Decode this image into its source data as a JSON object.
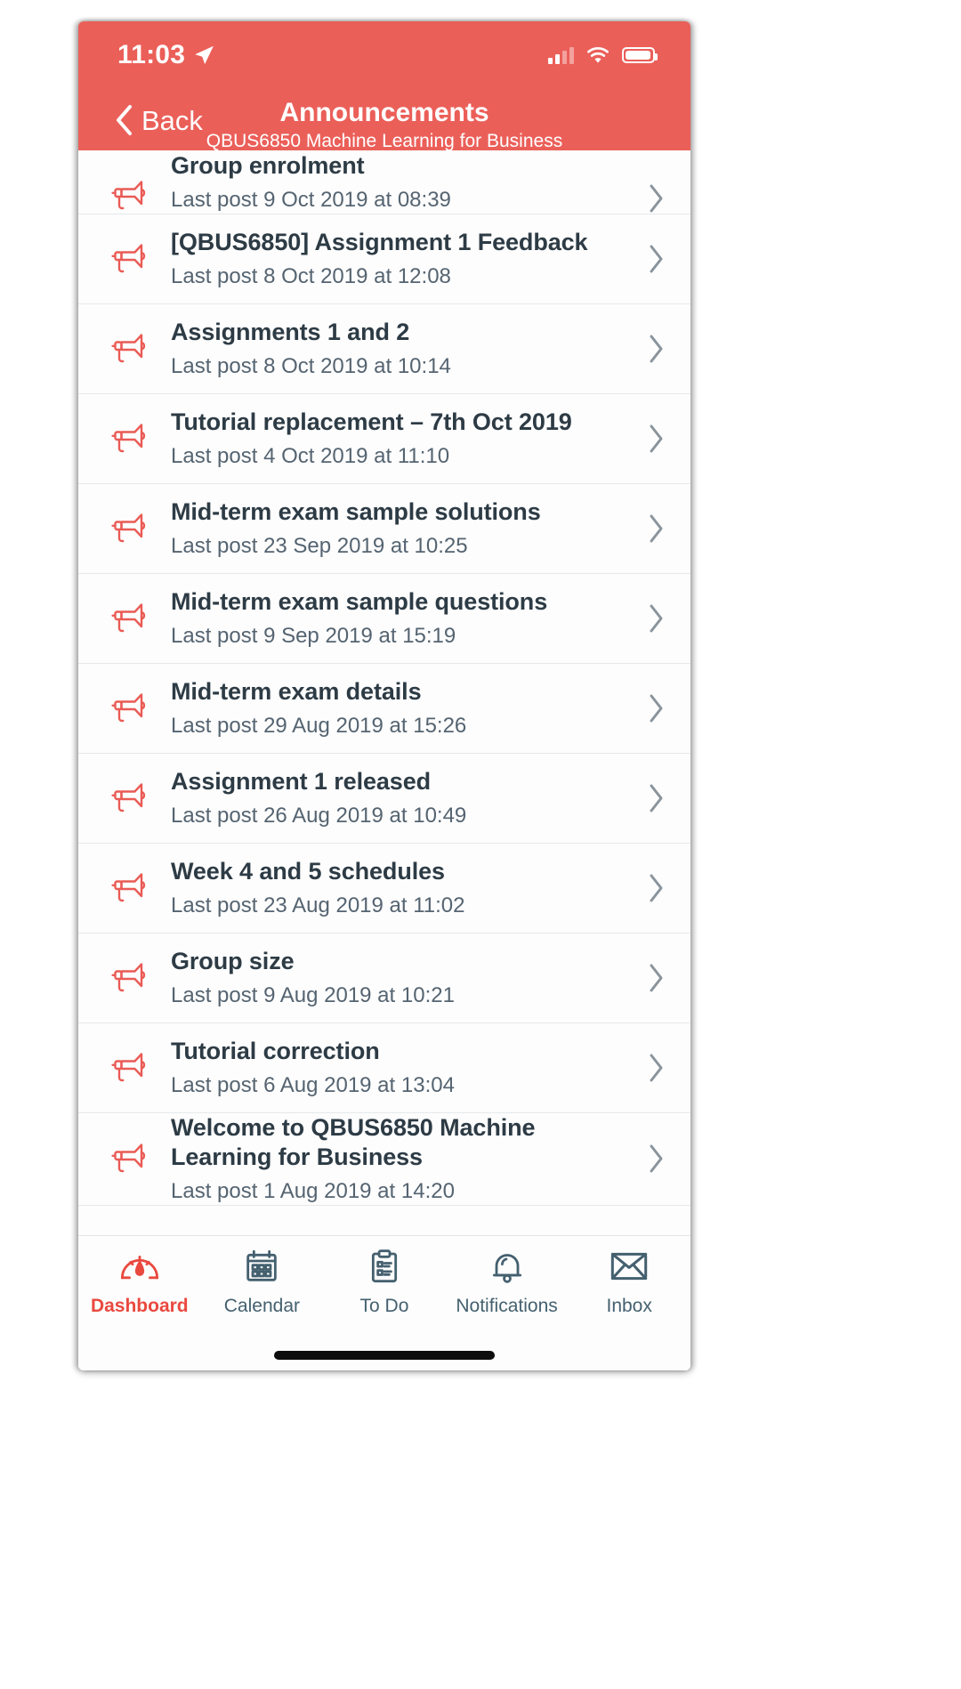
{
  "status_bar": {
    "time": "11:03",
    "location_icon": "location-arrow-icon",
    "signal_icon": "cellular-signal-icon",
    "wifi_icon": "wifi-icon",
    "battery_icon": "battery-full-icon"
  },
  "header": {
    "back_label": "Back",
    "back_icon": "chevron-left-icon",
    "title": "Announcements",
    "subtitle": "QBUS6850 Machine Learning for Business",
    "background_color": "#eb5f59"
  },
  "announcements": [
    {
      "title": "Group enrolment",
      "meta": "Last post 9 Oct 2019 at 08:39",
      "icon": "megaphone-icon",
      "chevron": "chevron-right-icon",
      "clipped": true
    },
    {
      "title": "[QBUS6850] Assignment 1 Feedback",
      "meta": "Last post 8 Oct 2019 at 12:08",
      "icon": "megaphone-icon",
      "chevron": "chevron-right-icon"
    },
    {
      "title": "Assignments 1 and 2",
      "meta": "Last post 8 Oct 2019 at 10:14",
      "icon": "megaphone-icon",
      "chevron": "chevron-right-icon"
    },
    {
      "title": "Tutorial replacement – 7th Oct 2019",
      "meta": "Last post 4 Oct 2019 at 11:10",
      "icon": "megaphone-icon",
      "chevron": "chevron-right-icon"
    },
    {
      "title": "Mid-term exam sample solutions",
      "meta": "Last post 23 Sep 2019 at 10:25",
      "icon": "megaphone-icon",
      "chevron": "chevron-right-icon"
    },
    {
      "title": "Mid-term exam sample questions",
      "meta": "Last post 9 Sep 2019 at 15:19",
      "icon": "megaphone-icon",
      "chevron": "chevron-right-icon"
    },
    {
      "title": "Mid-term exam details",
      "meta": "Last post 29 Aug 2019 at 15:26",
      "icon": "megaphone-icon",
      "chevron": "chevron-right-icon"
    },
    {
      "title": "Assignment 1 released",
      "meta": "Last post 26 Aug 2019 at 10:49",
      "icon": "megaphone-icon",
      "chevron": "chevron-right-icon"
    },
    {
      "title": "Week 4 and 5 schedules",
      "meta": "Last post 23 Aug 2019 at 11:02",
      "icon": "megaphone-icon",
      "chevron": "chevron-right-icon"
    },
    {
      "title": "Group size",
      "meta": "Last post 9 Aug 2019 at 10:21",
      "icon": "megaphone-icon",
      "chevron": "chevron-right-icon"
    },
    {
      "title": "Tutorial correction",
      "meta": "Last post 6 Aug 2019 at 13:04",
      "icon": "megaphone-icon",
      "chevron": "chevron-right-icon"
    },
    {
      "title": "Welcome to QBUS6850 Machine Learning for Business",
      "meta": "Last post 1 Aug 2019 at 14:20",
      "icon": "megaphone-icon",
      "chevron": "chevron-right-icon"
    }
  ],
  "tab_bar": {
    "active_color": "#e9493f",
    "inactive_color": "#44606f",
    "tabs": [
      {
        "label": "Dashboard",
        "icon": "gauge-icon",
        "active": true
      },
      {
        "label": "Calendar",
        "icon": "calendar-icon",
        "active": false
      },
      {
        "label": "To Do",
        "icon": "clipboard-icon",
        "active": false
      },
      {
        "label": "Notifications",
        "icon": "bell-icon",
        "active": false
      },
      {
        "label": "Inbox",
        "icon": "envelope-icon",
        "active": false
      }
    ]
  }
}
